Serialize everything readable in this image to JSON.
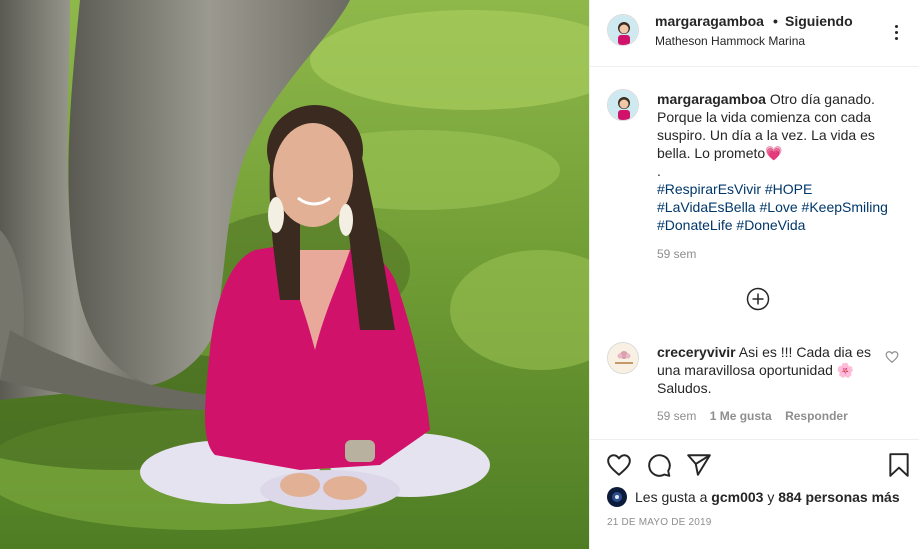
{
  "post": {
    "photo_alt": "Mujer sentada en el césped bajo un árbol",
    "owner": {
      "username": "margaragamboa",
      "dot": "•",
      "follow_status": "Siguiendo",
      "location": "Matheson Hammock Marina"
    },
    "caption": {
      "username": "margaragamboa",
      "text": "Otro día ganado. Porque la vida comienza con cada suspiro. Un día a la vez. La vida es bella. Lo prometo💗",
      "separator": ".",
      "hashtags": [
        "#RespirarEsVivir",
        "#HOPE",
        "#LaVidaEsBella",
        "#Love",
        "#KeepSmiling",
        "#DonateLife",
        "#DoneVida"
      ],
      "time": "59 sem"
    },
    "load_more_icon": "plus-circle-icon",
    "comments": [
      {
        "username": "creceryvivir",
        "text": "Asi es !!! Cada dia es una maravillosa oportunidad 🌸 Saludos.",
        "time": "59 sem",
        "likes": "1 Me gusta",
        "reply": "Responder"
      }
    ],
    "actions": {
      "icons": [
        "heart-icon",
        "comment-icon",
        "share-icon",
        "bookmark-icon"
      ]
    },
    "likes": {
      "prefix": "Les gusta a",
      "user": "gcm003",
      "conj": "y",
      "others": "884 personas más"
    },
    "date": "21 DE MAYO DE 2019"
  },
  "colors": {
    "text": "#262626",
    "secondary": "#8e8e8e",
    "hashtag": "#00376b",
    "border": "#efefef",
    "heart": "#ed4956"
  }
}
